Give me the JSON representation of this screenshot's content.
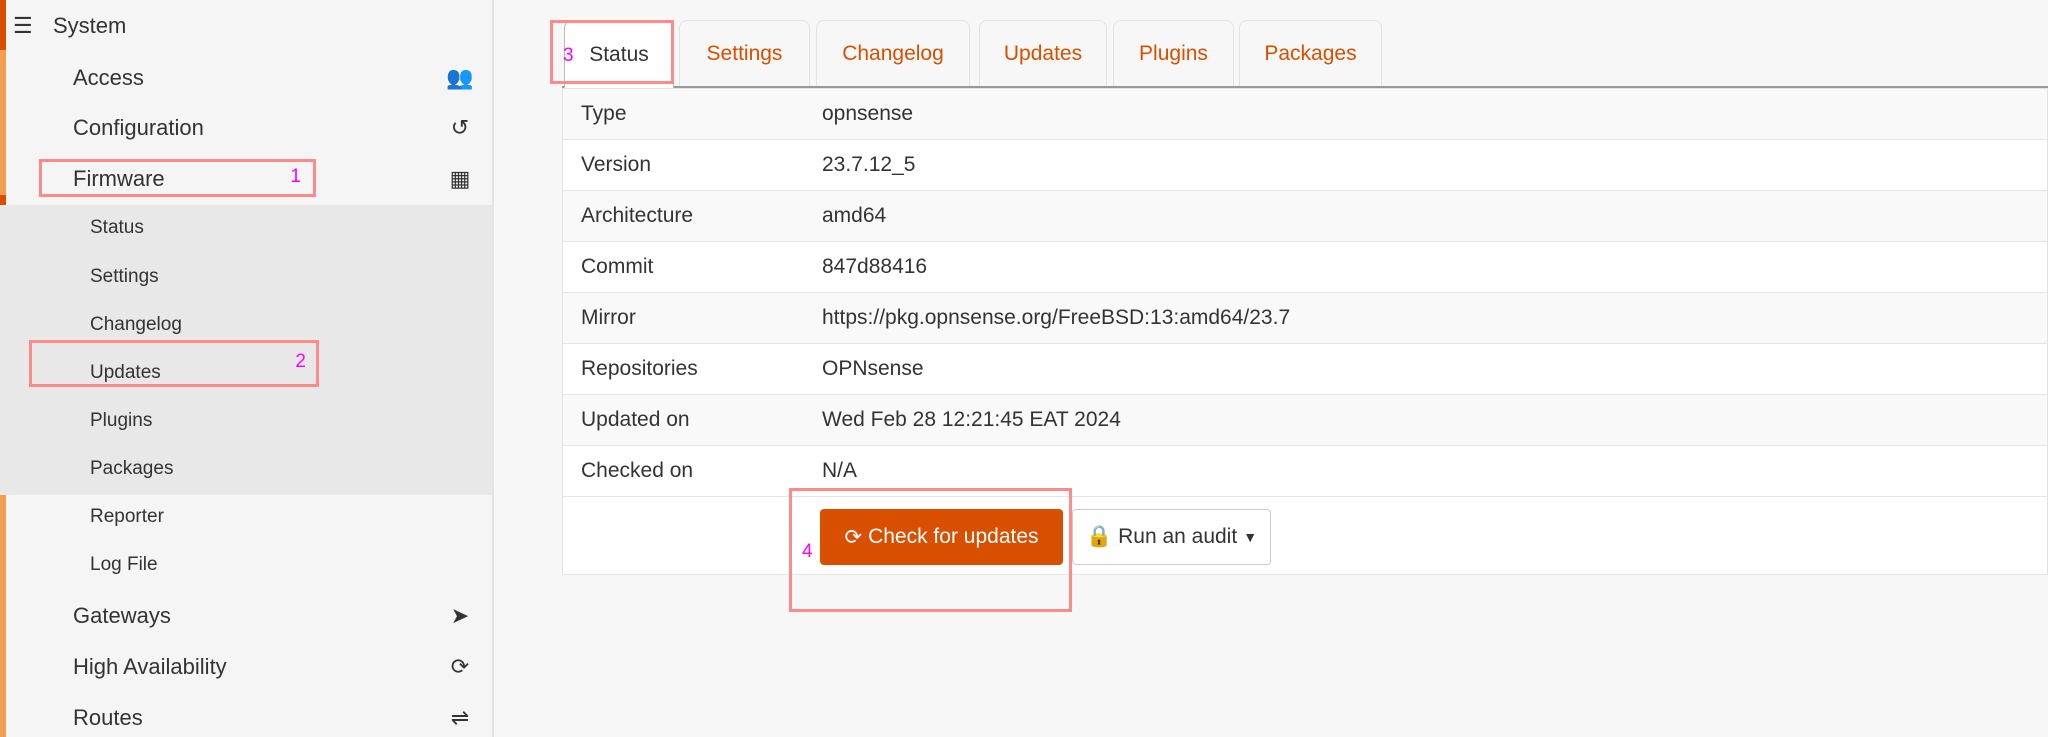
{
  "sidebar": {
    "section": "System",
    "items": [
      {
        "label": "Access",
        "icon": "users-icon"
      },
      {
        "label": "Configuration",
        "icon": "history-icon"
      },
      {
        "label": "Firmware",
        "icon": "building-icon"
      }
    ],
    "submenu": [
      "Status",
      "Settings",
      "Changelog",
      "Updates",
      "Plugins",
      "Packages",
      "Reporter",
      "Log File"
    ],
    "items_after": [
      {
        "label": "Gateways",
        "icon": "location-arrow-icon"
      },
      {
        "label": "High Availability",
        "icon": "refresh-icon"
      },
      {
        "label": "Routes",
        "icon": "signpost-icon"
      }
    ]
  },
  "tabs": [
    "Status",
    "Settings",
    "Changelog",
    "Updates",
    "Plugins",
    "Packages"
  ],
  "status_table": [
    {
      "key": "Type",
      "value": "opnsense"
    },
    {
      "key": "Version",
      "value": "23.7.12_5"
    },
    {
      "key": "Architecture",
      "value": "amd64"
    },
    {
      "key": "Commit",
      "value": "847d88416"
    },
    {
      "key": "Mirror",
      "value": "https://pkg.opnsense.org/FreeBSD:13:amd64/23.7"
    },
    {
      "key": "Repositories",
      "value": "OPNsense"
    },
    {
      "key": "Updated on",
      "value": "Wed Feb 28 12:21:45 EAT 2024"
    },
    {
      "key": "Checked on",
      "value": "N/A"
    }
  ],
  "buttons": {
    "check": "Check for updates",
    "audit": "Run an audit"
  },
  "annotations": [
    "1",
    "2",
    "3",
    "4"
  ],
  "colors": {
    "accent": "#d94f00",
    "annotation": "#ff8a8a",
    "annotation_text": "#ff00ff"
  }
}
